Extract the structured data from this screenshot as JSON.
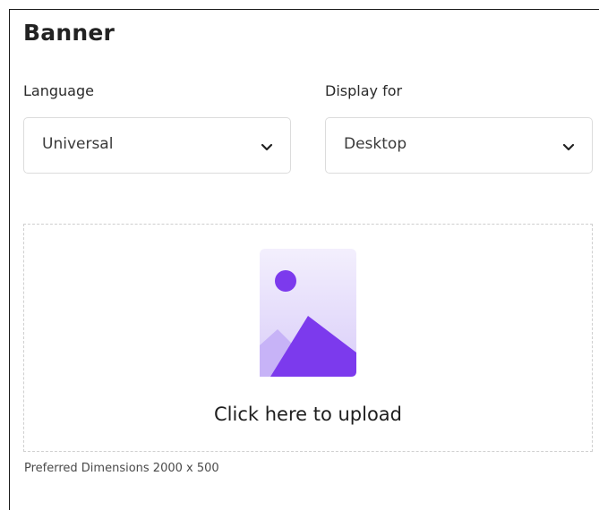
{
  "banner": {
    "title": "Banner",
    "language": {
      "label": "Language",
      "value": "Universal"
    },
    "display_for": {
      "label": "Display for",
      "value": "Desktop"
    },
    "upload": {
      "text": "Click here to upload",
      "icon": "image-placeholder-icon"
    },
    "hint": "Preferred Dimensions 2000 x 500",
    "colors": {
      "accent": "#7c3aed",
      "accent_light": "#ede7fb"
    }
  }
}
